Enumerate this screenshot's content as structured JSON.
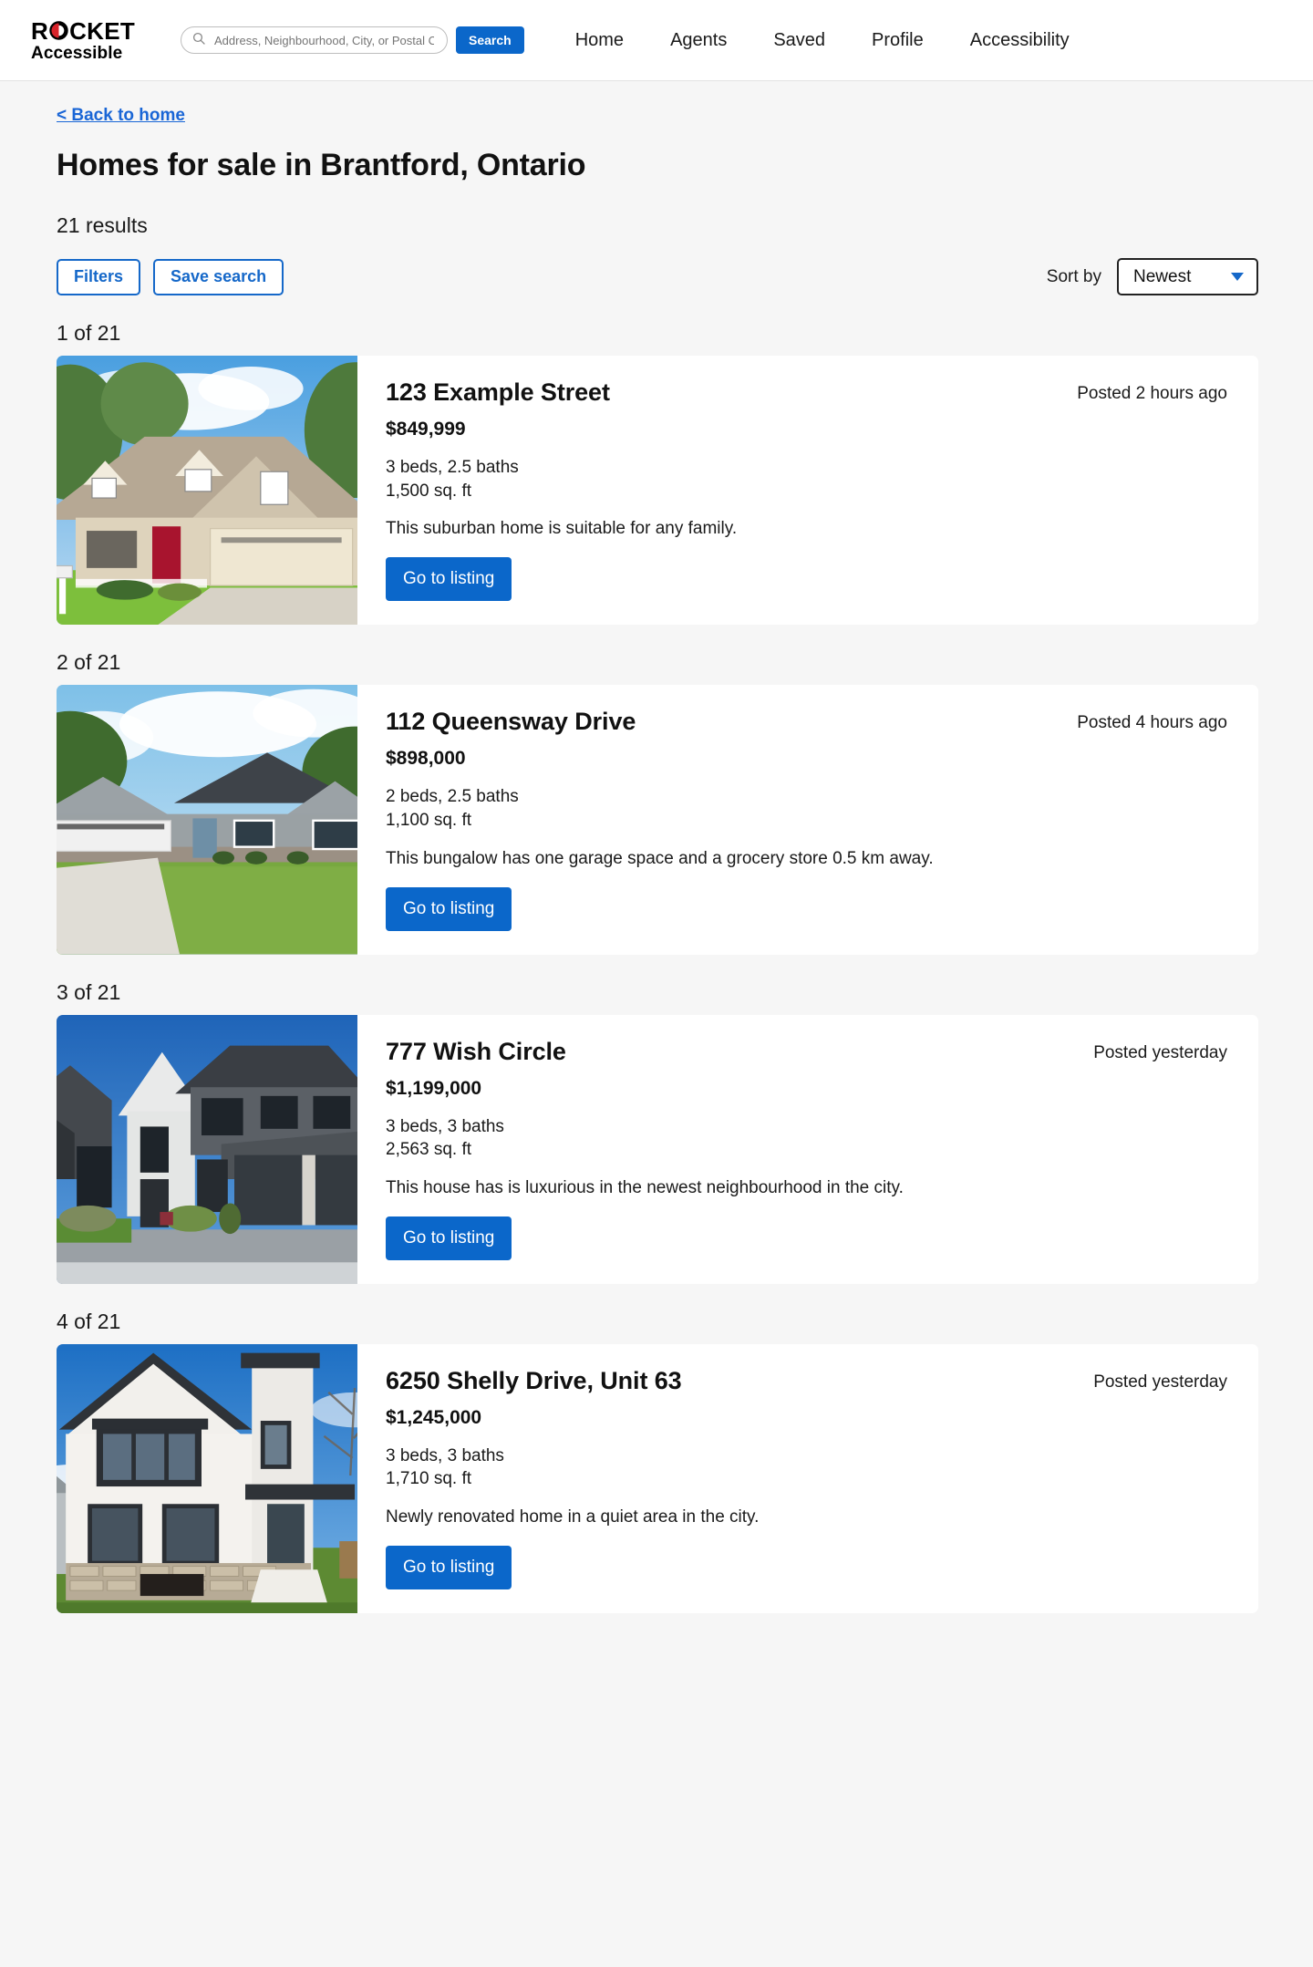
{
  "header": {
    "logo_line1": "ROCKET",
    "logo_line2": "Accessible",
    "logo_icon": "rocket-o-ring-icon",
    "search": {
      "icon": "search-icon",
      "placeholder": "Address, Neighbourhood, City, or Postal Code",
      "value": "",
      "button_label": "Search"
    },
    "nav": [
      {
        "label": "Home",
        "name": "nav-home"
      },
      {
        "label": "Agents",
        "name": "nav-agents"
      },
      {
        "label": "Saved",
        "name": "nav-saved"
      },
      {
        "label": "Profile",
        "name": "nav-profile"
      },
      {
        "label": "Accessibility",
        "name": "nav-accessibility"
      }
    ]
  },
  "breadcrumb": {
    "back_label": "< Back to home"
  },
  "main": {
    "title": "Homes for sale in Brantford, Ontario",
    "results_count": "21 results",
    "filters_label": "Filters",
    "save_search_label": "Save search",
    "sort_label": "Sort by",
    "sort_value": "Newest",
    "sort_options": [
      "Newest"
    ],
    "caret_icon": "chevron-down-icon"
  },
  "listings": [
    {
      "index_label": "1 of 21",
      "address": "123 Example Street",
      "price": "$849,999",
      "beds_baths": "3 beds, 2.5 baths",
      "area": "1,500 sq. ft",
      "description": "This suburban home is suitable for any family.",
      "posted": "Posted 2 hours ago",
      "cta_label": "Go to listing",
      "photo_alt": "beige suburban two-story house with red front door and attached garage"
    },
    {
      "index_label": "2 of 21",
      "address": "112 Queensway Drive",
      "price": "$898,000",
      "beds_baths": "2 beds, 2.5 baths",
      "area": "1,100 sq. ft",
      "description": "This bungalow has one garage space and a grocery store 0.5 km away.",
      "posted": "Posted 4 hours ago",
      "cta_label": "Go to listing",
      "photo_alt": "grey single-storey bungalow with dark shingle roof and white garage door"
    },
    {
      "index_label": "3 of 21",
      "address": "777 Wish Circle",
      "price": "$1,199,000",
      "beds_baths": "3 beds, 3 baths",
      "area": "2,563 sq. ft",
      "description": "This house has is luxurious in the newest neighbourhood in the city.",
      "posted": "Posted yesterday",
      "cta_label": "Go to listing",
      "photo_alt": "modern dark grey two-storey house with white stone accent and double garage"
    },
    {
      "index_label": "4 of 21",
      "address": "6250 Shelly Drive, Unit 63",
      "price": "$1,245,000",
      "beds_baths": "3 beds, 3 baths",
      "area": "1,710 sq. ft",
      "description": "Newly renovated home in a quiet area in the city.",
      "posted": "Posted yesterday",
      "cta_label": "Go to listing",
      "photo_alt": "white modern farmhouse with black trim windows and stone foundation"
    }
  ],
  "colors": {
    "brand_blue": "#0b67ca",
    "link_blue": "#1a66d6",
    "outline_blue": "#1568c9",
    "page_bg": "#f6f6f6",
    "card_bg": "#ffffff",
    "text": "#1a1a1a",
    "logo_accent_red": "#d8232a"
  }
}
